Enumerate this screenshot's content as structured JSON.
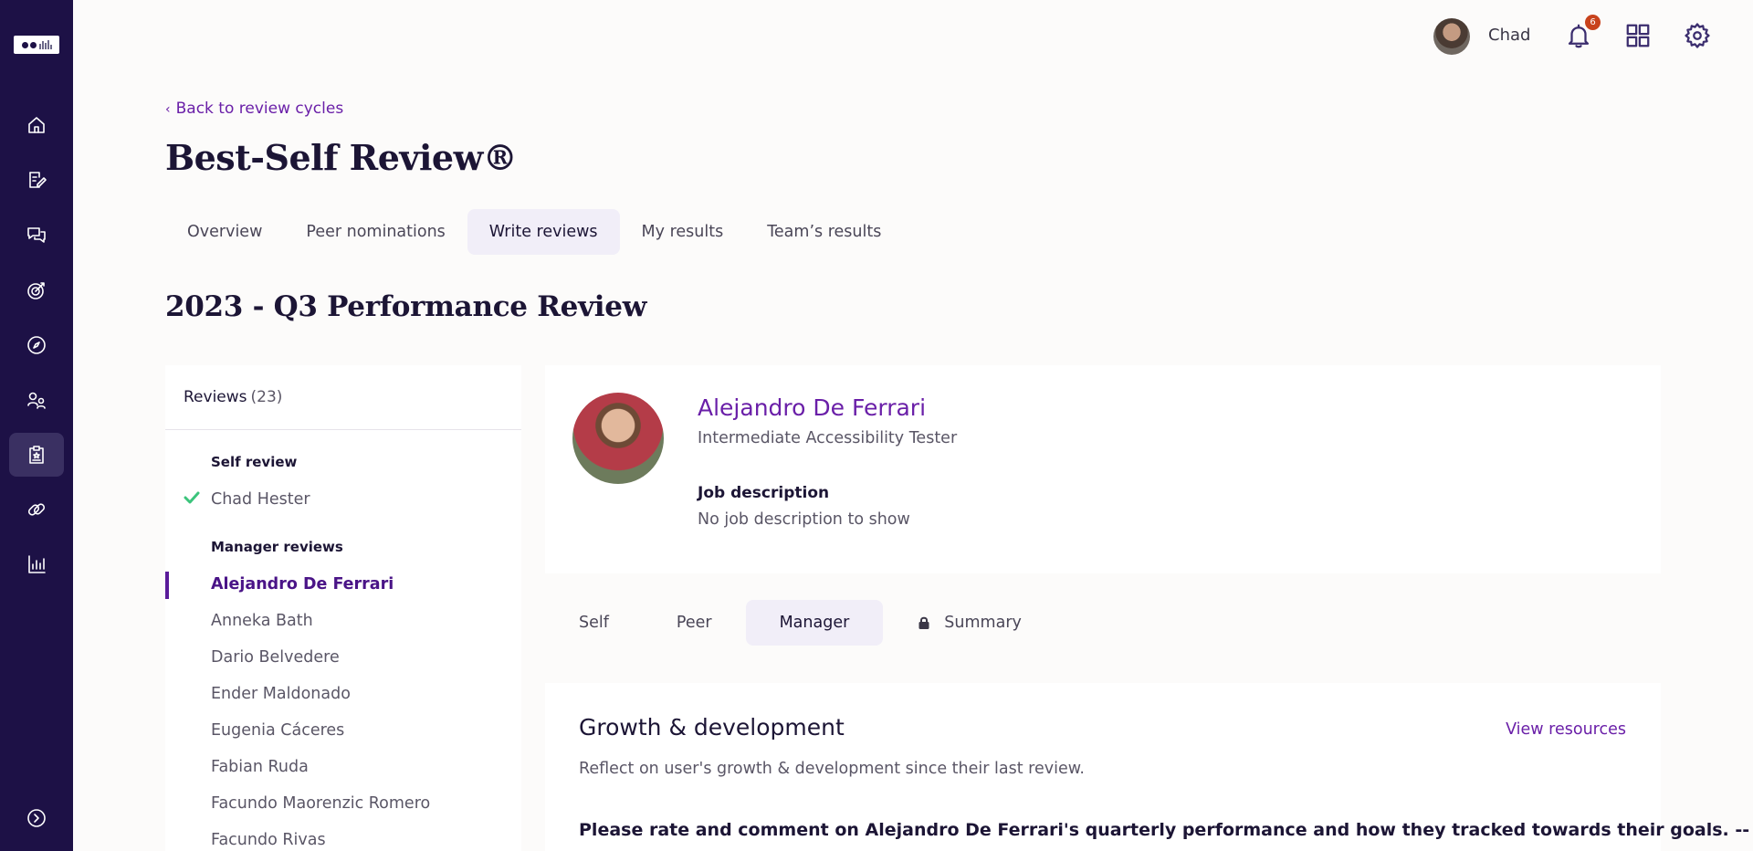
{
  "user": {
    "name": "Chad",
    "notification_count": "6"
  },
  "nav": {
    "back_link": "Back to review cycles",
    "page_title": "Best-Self Review®",
    "tabs": [
      "Overview",
      "Peer nominations",
      "Write reviews",
      "My results",
      "Team’s results"
    ],
    "active_tab": "Write reviews"
  },
  "cycle_title": "2023 - Q3 Performance Review",
  "reviews": {
    "label": "Reviews",
    "count": "(23)",
    "self_group": "Self review",
    "self_items": [
      "Chad Hester"
    ],
    "manager_group": "Manager reviews",
    "manager_items": [
      "Alejandro De Ferrari",
      "Anneka Bath",
      "Dario Belvedere",
      "Ender Maldonado",
      "Eugenia Cáceres",
      "Fabian Ruda",
      "Facundo Maorenzic Romero",
      "Facundo Rivas"
    ],
    "active_item": "Alejandro De Ferrari"
  },
  "profile": {
    "name": "Alejandro De Ferrari",
    "role": "Intermediate Accessibility Tester",
    "job_label": "Job description",
    "job_text": "No job description to show"
  },
  "review_tabs": [
    "Self",
    "Peer",
    "Manager",
    "Summary"
  ],
  "active_review_tab": "Manager",
  "growth": {
    "title": "Growth & development",
    "view_resources": "View resources",
    "description": "Reflect on user's growth & development since their last review.",
    "question": "Please rate and comment on Alejandro De Ferrari's quarterly performance and how they tracked towards their goals. --"
  },
  "colors": {
    "sidebar": "#1d1146",
    "accent": "#6a1fa8",
    "badge": "#c8421c",
    "check": "#3cc47c"
  },
  "icons": {
    "sidebar": [
      "home-icon",
      "edit-note-icon",
      "chat-icon",
      "target-icon",
      "compass-icon",
      "people-icon",
      "review-clipboard-icon",
      "link-icon",
      "bar-chart-icon",
      "expand-arrow-icon"
    ],
    "topbar": [
      "bell-icon",
      "apps-grid-icon",
      "gear-icon"
    ]
  }
}
